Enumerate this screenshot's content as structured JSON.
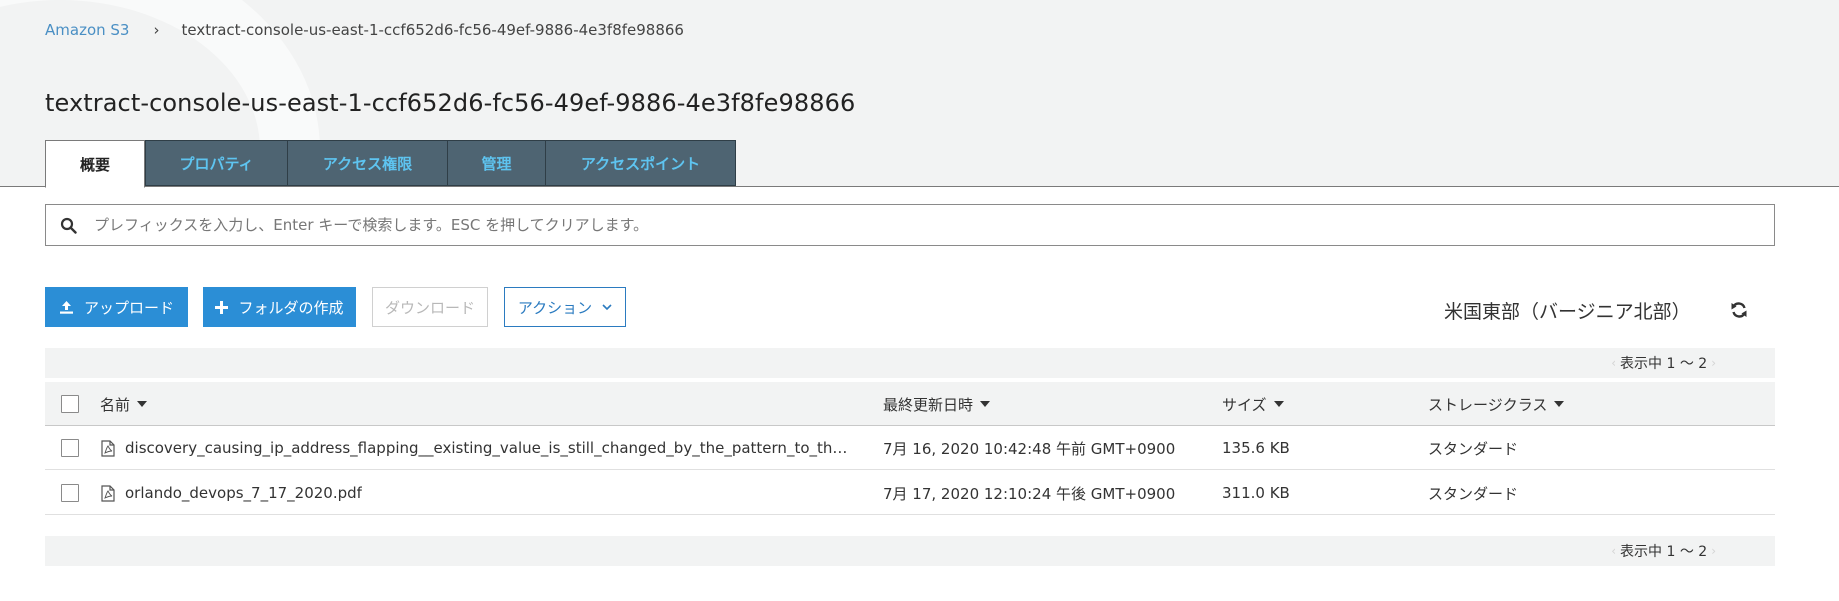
{
  "breadcrumb": {
    "root": "Amazon S3",
    "separator": "›",
    "current": "textract-console-us-east-1-ccf652d6-fc56-49ef-9886-4e3f8fe98866"
  },
  "page_title": "textract-console-us-east-1-ccf652d6-fc56-49ef-9886-4e3f8fe98866",
  "tabs": [
    {
      "label": "概要",
      "active": true
    },
    {
      "label": "プロパティ",
      "active": false
    },
    {
      "label": "アクセス権限",
      "active": false
    },
    {
      "label": "管理",
      "active": false
    },
    {
      "label": "アクセスポイント",
      "active": false
    }
  ],
  "search": {
    "placeholder": "プレフィックスを入力し、Enter キーで検索します。ESC を押してクリアします。",
    "value": ""
  },
  "toolbar": {
    "upload": "アップロード",
    "create_folder": "フォルダの作成",
    "download": "ダウンロード",
    "actions": "アクション"
  },
  "region": "米国東部（バージニア北部）",
  "pager": {
    "text": "表示中 1 〜 2",
    "prev": "‹",
    "next": "›"
  },
  "table": {
    "columns": {
      "name": "名前",
      "modified": "最終更新日時",
      "size": "サイズ",
      "storage_class": "ストレージクラス"
    },
    "rows": [
      {
        "name": "discovery_causing_ip_address_flapping__existing_value_is_still_changed_by_the_pattern_to_the_ip_w...",
        "modified": "7月 16, 2020 10:42:48 午前 GMT+0900",
        "size": "135.6 KB",
        "storage_class": "スタンダード",
        "icon": "pdf-file-icon"
      },
      {
        "name": "orlando_devops_7_17_2020.pdf",
        "modified": "7月 17, 2020 12:10:24 午後 GMT+0900",
        "size": "311.0 KB",
        "storage_class": "スタンダード",
        "icon": "pdf-file-icon"
      }
    ]
  },
  "colors": {
    "link": "#4a8fc4",
    "primary_button": "#2b8ed6",
    "tab_bg": "#4e6472",
    "tab_text": "#5ec4f0",
    "band_bg": "#f2f3f3"
  }
}
